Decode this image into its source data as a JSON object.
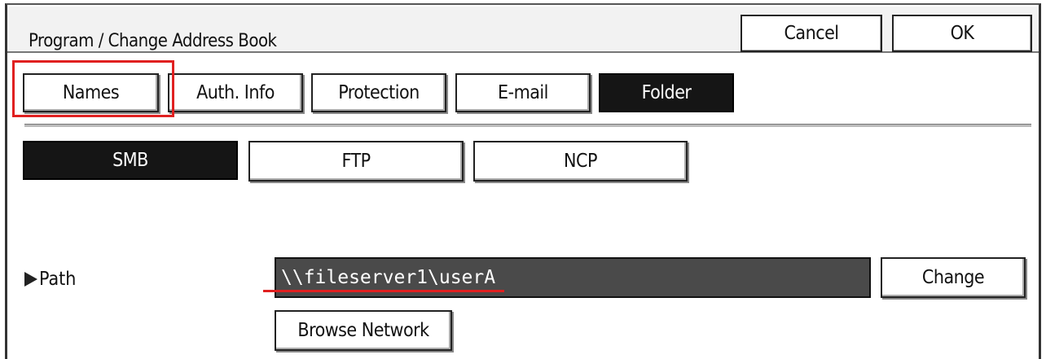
{
  "header": {
    "title": "Program / Change Address Book",
    "cancel_label": "Cancel",
    "ok_label": "OK"
  },
  "tabs": [
    {
      "label": "Names",
      "selected": false
    },
    {
      "label": "Auth. Info",
      "selected": false
    },
    {
      "label": "Protection",
      "selected": false
    },
    {
      "label": "E-mail",
      "selected": false
    },
    {
      "label": "Folder",
      "selected": true
    }
  ],
  "protocols": [
    {
      "label": "SMB",
      "selected": true
    },
    {
      "label": "FTP",
      "selected": false
    },
    {
      "label": "NCP",
      "selected": false
    }
  ],
  "path": {
    "label": "Path",
    "value": "\\\\fileserver1\\userA",
    "change_label": "Change",
    "browse_label": "Browse Network"
  },
  "colors": {
    "annotation": "#e02020",
    "selected_bg": "#151515",
    "field_bg": "#4a4a4a"
  }
}
